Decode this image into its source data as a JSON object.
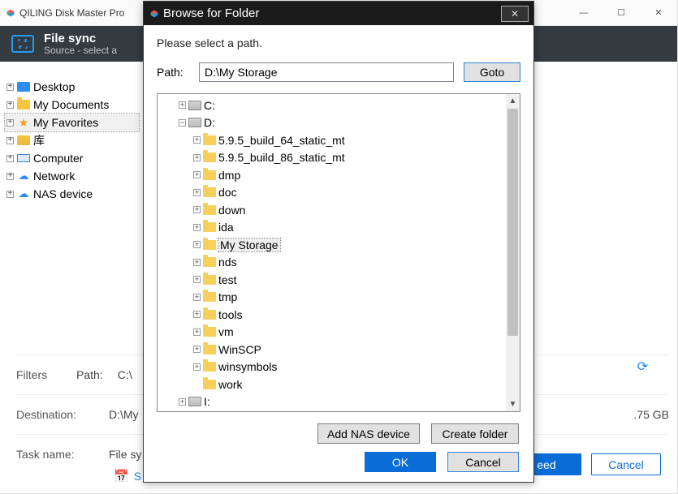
{
  "app": {
    "title": "QILING Disk Master Pro",
    "wincontrols": {
      "min": "—",
      "max": "☐",
      "close": "✕"
    }
  },
  "ribbon": {
    "title": "File sync",
    "subtitle": "Source - select a"
  },
  "side_tree": {
    "items": [
      {
        "label": "Desktop",
        "icon": "desktop"
      },
      {
        "label": "My Documents",
        "icon": "folder"
      },
      {
        "label": "My Favorites",
        "icon": "star",
        "selected": true
      },
      {
        "label": "库",
        "icon": "library"
      },
      {
        "label": "Computer",
        "icon": "monitor"
      },
      {
        "label": "Network",
        "icon": "network"
      },
      {
        "label": "NAS device",
        "icon": "nas"
      }
    ]
  },
  "lower": {
    "filters_label": "Filters",
    "path_label": "Path:",
    "path_value": "C:\\",
    "destination_label": "Destination:",
    "destination_value": "D:\\My",
    "task_label": "Task name:",
    "task_value": "File sy",
    "schedule_label": "S",
    "proceed_label": "eed",
    "cancel_label": "Cancel",
    "disk_free": ".75 GB"
  },
  "dialog": {
    "title": "Browse for Folder",
    "close_glyph": "✕",
    "instruction": "Please select a path.",
    "path_label": "Path:",
    "path_value": "D:\\My Storage",
    "goto_label": "Goto",
    "tree": {
      "c_drive": "C:",
      "d_drive": "D:",
      "d_children": [
        "5.9.5_build_64_static_mt",
        "5.9.5_build_86_static_mt",
        "dmp",
        "doc",
        "down",
        "ida",
        "My Storage",
        "nds",
        "test",
        "tmp",
        "tools",
        "vm",
        "WinSCP",
        "winsymbols",
        "work"
      ],
      "i_drive": "I:"
    },
    "add_nas_label": "Add NAS device",
    "create_folder_label": "Create folder",
    "ok_label": "OK",
    "cancel_label": "Cancel"
  }
}
